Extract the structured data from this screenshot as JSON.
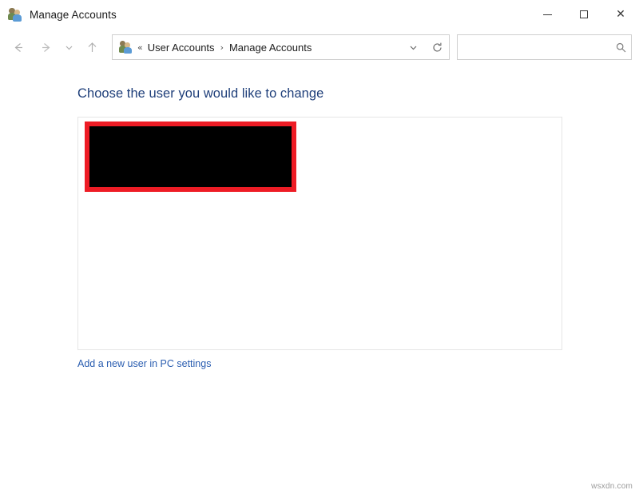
{
  "window": {
    "title": "Manage Accounts",
    "icon": "user-accounts-icon",
    "controls": {
      "minimize_label": "Minimize",
      "maximize_label": "Maximize",
      "close_label": "Close",
      "close_glyph": "✕"
    }
  },
  "navigation": {
    "back_label": "Back",
    "forward_label": "Forward",
    "recent_label": "Recent locations",
    "up_label": "Up one level",
    "breadcrumb": {
      "icon": "user-accounts-icon",
      "overflow_glyph": "«",
      "items": [
        {
          "label": "User Accounts"
        },
        {
          "label": "Manage Accounts"
        }
      ],
      "separator": "›"
    },
    "dropdown_label": "Previous locations",
    "refresh_label": "Refresh"
  },
  "search": {
    "value": "",
    "placeholder": "",
    "icon": "search-icon"
  },
  "main": {
    "heading": "Choose the user you would like to change",
    "user_panel": {
      "redaction": {
        "description": "redacted user account entry",
        "fill_color": "#000000",
        "border_color": "#ee1c25"
      }
    },
    "add_user_link": "Add a new user in PC settings"
  },
  "watermark": "wsxdn.com",
  "colors": {
    "heading": "#1f3f7a",
    "link": "#2a5db0",
    "panel_border": "#e6e6e6",
    "redaction_border": "#ee1c25",
    "redaction_fill": "#000000",
    "window_background": "#ffffff"
  }
}
